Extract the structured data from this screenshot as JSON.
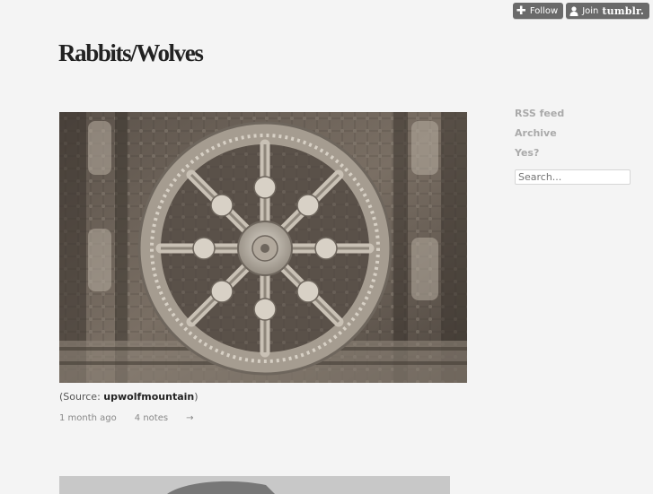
{
  "topbar": {
    "follow_label": "Follow",
    "join_label": "Join",
    "brand": "tumblr."
  },
  "blog": {
    "title": "Rabbits/Wolves"
  },
  "sidebar": {
    "links": [
      {
        "label": "RSS feed"
      },
      {
        "label": "Archive"
      },
      {
        "label": "Yes?"
      }
    ],
    "search_placeholder": "Search..."
  },
  "post": {
    "image_alt": "Carved stone chariot wheel",
    "source_prefix": "(Source: ",
    "source_name": "upwolfmountain",
    "source_suffix": ")",
    "time_ago": "1 month ago",
    "notes": "4 notes",
    "permalink_glyph": "→"
  },
  "colors": {
    "background": "#f4f4f4",
    "title": "#222222",
    "sidebar_link": "#aaaaaa",
    "button_bg": "#6a6a6a"
  }
}
